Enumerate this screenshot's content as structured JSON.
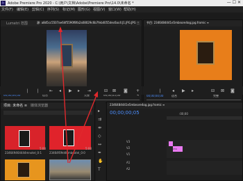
{
  "window": {
    "title": "Adobe Premiere Pro 2020 - C:\\用户\\文档\\Adobe\\Premiere Pro\\14.0\\未命名 *"
  },
  "menu": [
    "文件(F)",
    "编辑(E)",
    "剪辑(C)",
    "序列(S)",
    "标记(M)",
    "图形(G)",
    "视图(V)",
    "窗口(W)",
    "帮助(H)"
  ],
  "source_monitor": {
    "tab_label": "Lumetri 范围",
    "clip_tab": "源: a8d5cc5507ae64f5590f8fa2a08029c6b7feb4055dec6ac4:J1.JPG.JPG 三",
    "timecode": "00;00;00;00",
    "fit_label": "适合",
    "resolution_label": "完整",
    "duration": "00;00;05;00"
  },
  "program_monitor": {
    "tab_label": "节目: 2346484441e5mbnore4og.jpg.fromic ≡",
    "timecode": "00;00;00;00",
    "fit_label": "适合",
    "resolution_label": "完整"
  },
  "project_panel": {
    "tabs": [
      "项目: 未命名 ≡",
      "媒体浏览器"
    ],
    "items": [
      {
        "name": "234649464444mnotel_0:1",
        "duration": "5:00"
      },
      {
        "name": "23464f09d40mbnotel_0:0",
        "duration": "5:00"
      },
      {
        "name": "",
        "duration": ""
      },
      {
        "name": "",
        "duration": ""
      }
    ]
  },
  "timeline": {
    "tab_label": "2346484441e5mbnore4og.jpg.fromic ≡",
    "timecode": "00;00;00;05",
    "ruler_label": ":00;00",
    "tracks": [
      "V3",
      "V2",
      "V1",
      "A1",
      "A2"
    ],
    "clip_label": "234"
  },
  "icons": [
    "premiere-logo-icon",
    "tool-select-icon",
    "tool-track-icon",
    "tool-ripple-icon",
    "tool-razor-icon",
    "tool-slip-icon",
    "tool-pen-icon",
    "tool-hand-icon",
    "tool-type-icon",
    "play-icon",
    "step-back-icon",
    "step-forward-icon",
    "insert-icon",
    "overwrite-icon",
    "export-frame-icon",
    "wrench-icon",
    "plus-icon",
    "arrow-annotation-icon"
  ],
  "colors": {
    "accent": "#4d8fff",
    "arrow": "#e0282c",
    "clip": "#e879f0",
    "timecode": "#4d8fff"
  }
}
